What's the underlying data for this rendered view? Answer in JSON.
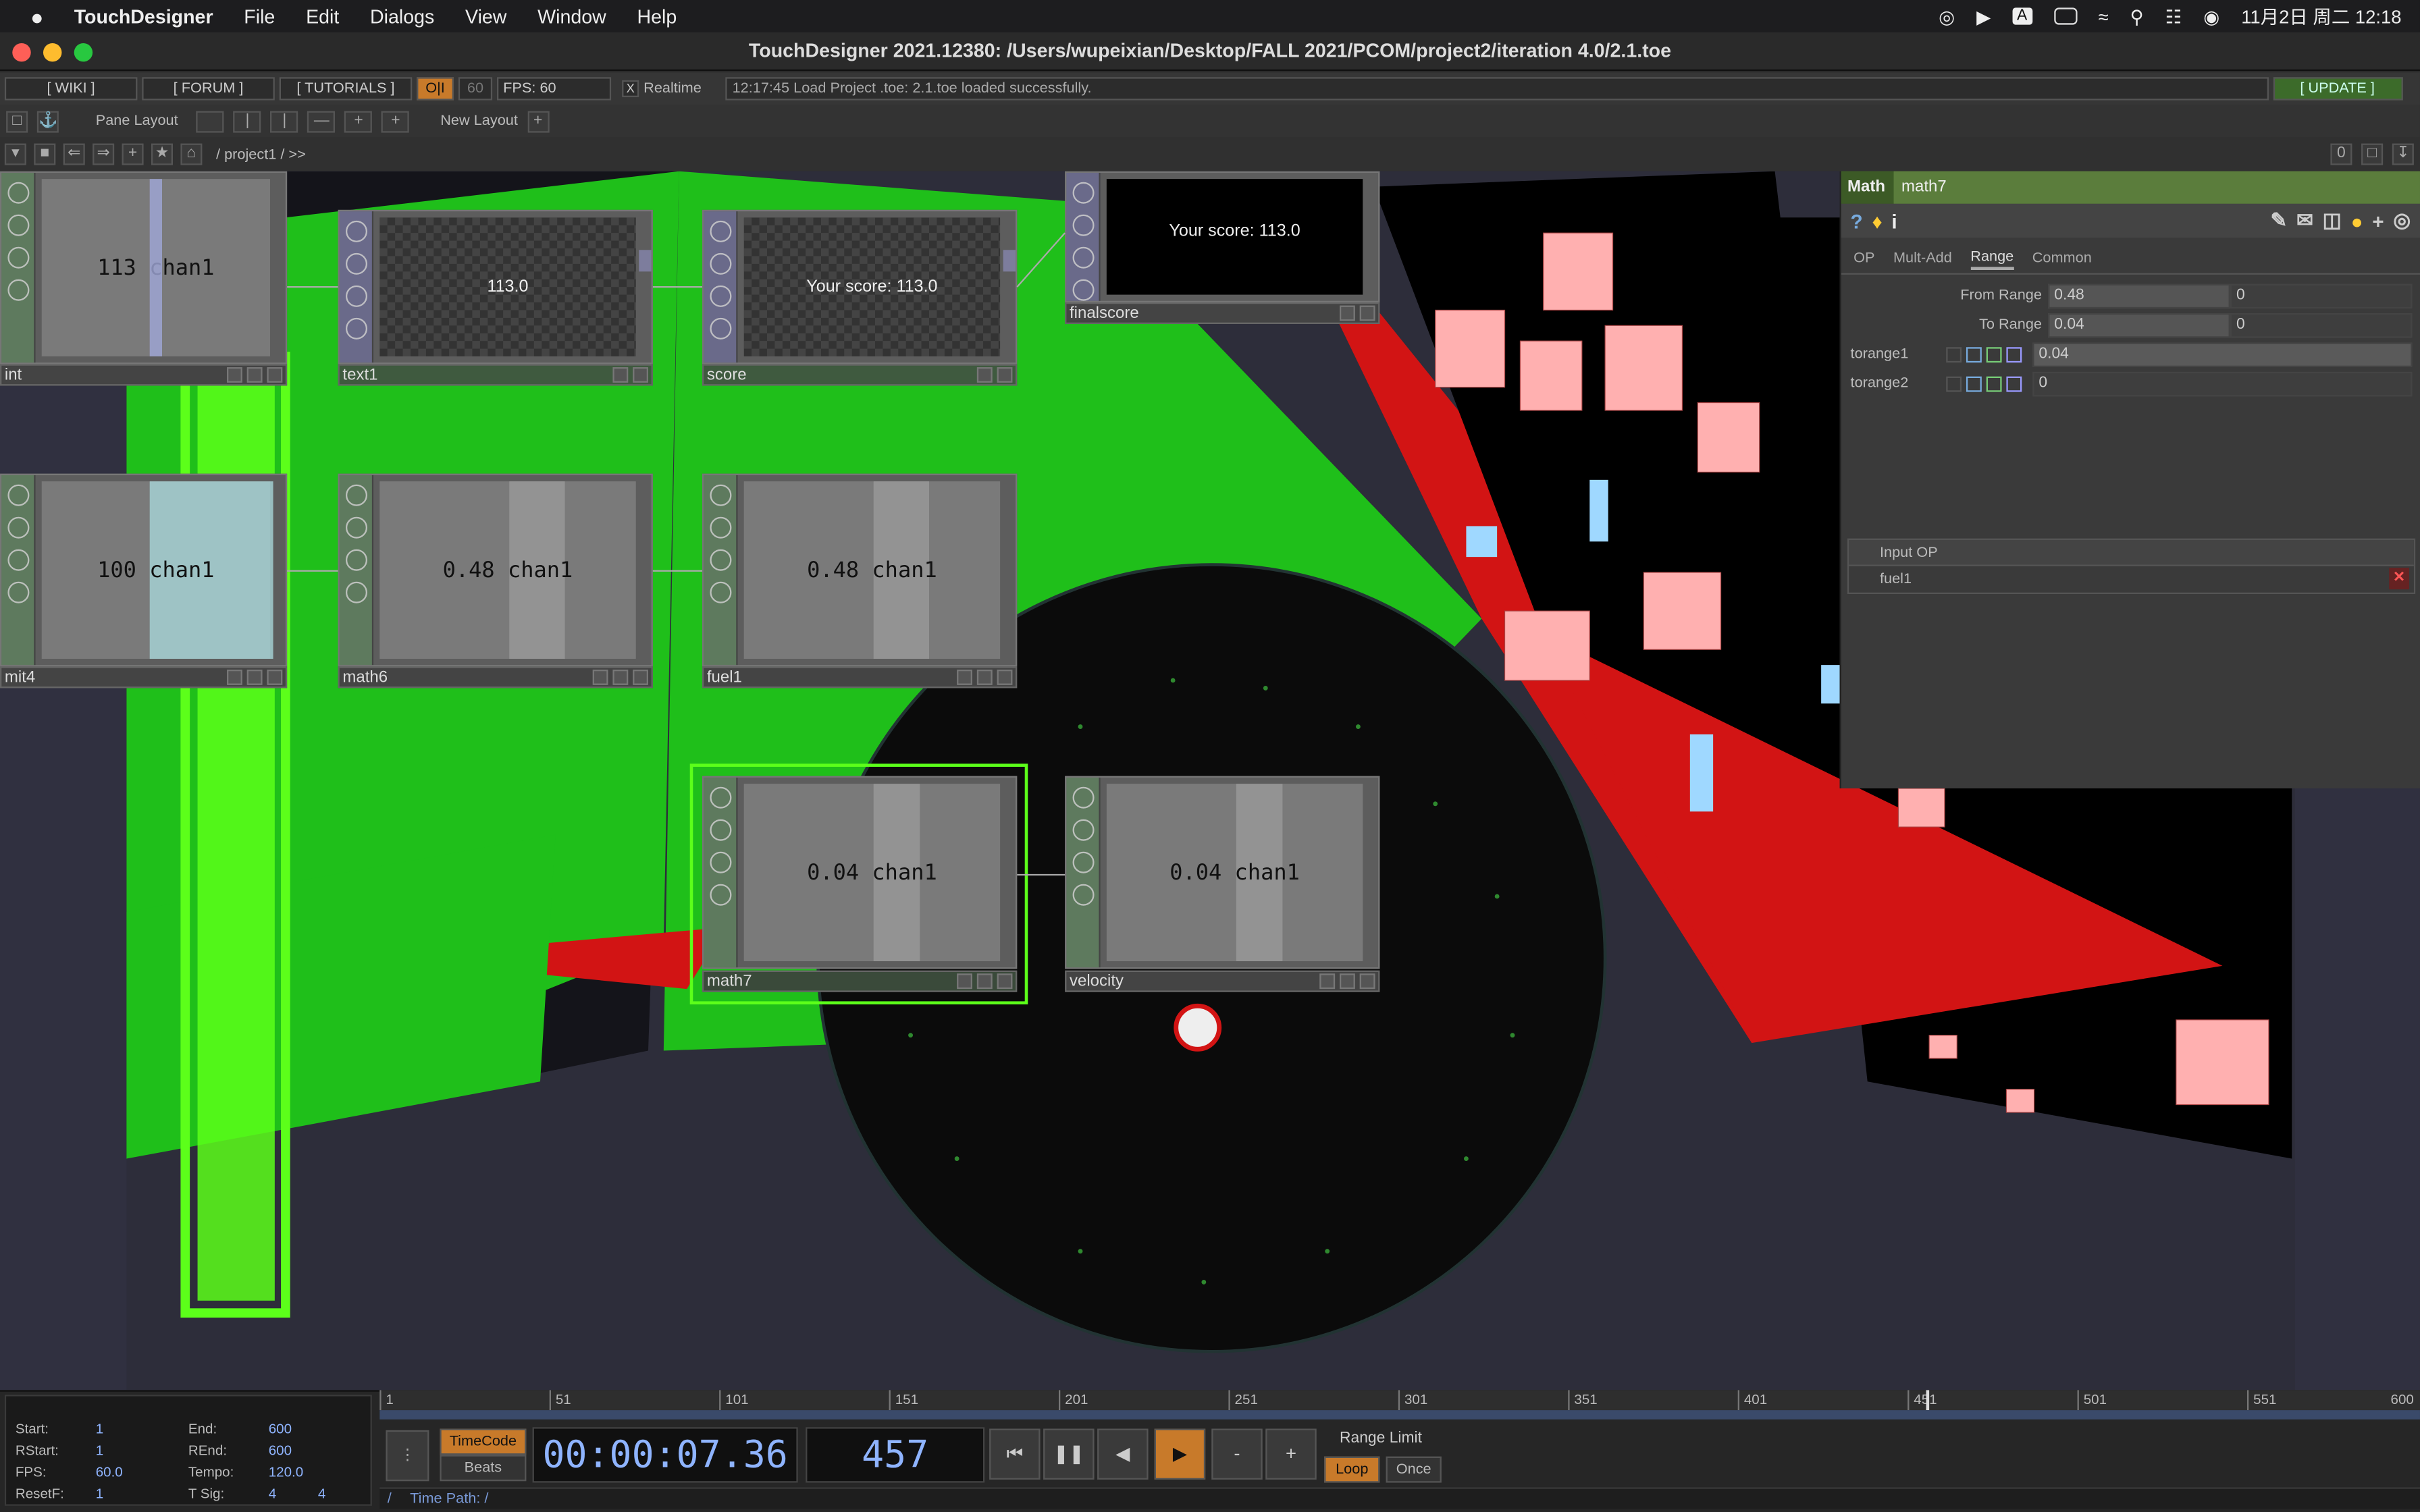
{
  "menubar": {
    "app": "TouchDesigner",
    "items": [
      "File",
      "Edit",
      "Dialogs",
      "View",
      "Window",
      "Help"
    ],
    "datetime": "11月2日 周二  12:18",
    "input_method": "A"
  },
  "window": {
    "title": "TouchDesigner 2021.12380: /Users/wupeixian/Desktop/FALL 2021/PCOM/project2/iteration 4.0/2.1.toe"
  },
  "toolbar": {
    "wiki": "[ WIKI ]",
    "forum": "[ FORUM ]",
    "tutorials": "[ TUTORIALS ]",
    "perf": "O|I",
    "fps_value": "60",
    "fps_label": "FPS:",
    "fps_current": "60",
    "realtime_check": "X",
    "realtime": "Realtime",
    "status": "12:17:45 Load Project .toe: 2.1.toe loaded successfully.",
    "update": "[ UPDATE ]",
    "pane_layout": "Pane Layout",
    "new_layout": "New Layout",
    "plus": "+",
    "path": "/ project1 / >>",
    "pane_index": "0"
  },
  "nodes": [
    {
      "id": "int",
      "label": "int",
      "value": "113",
      "chan": "chan1"
    },
    {
      "id": "text1",
      "label": "text1",
      "value": "113.0"
    },
    {
      "id": "score",
      "label": "score",
      "value": "Your score: 113.0"
    },
    {
      "id": "finalscore",
      "label": "finalscore",
      "value": "Your score: 113.0"
    },
    {
      "id": "mit4",
      "label": "mit4",
      "value": "100",
      "chan": "chan1"
    },
    {
      "id": "math6",
      "label": "math6",
      "value": "0.48",
      "chan": "chan1"
    },
    {
      "id": "fuel1",
      "label": "fuel1",
      "value": "0.48",
      "chan": "chan1"
    },
    {
      "id": "math7",
      "label": "math7",
      "value": "0.04",
      "chan": "chan1"
    },
    {
      "id": "velocity",
      "label": "velocity",
      "value": "0.04",
      "chan": "chan1"
    }
  ],
  "params": {
    "type": "Math",
    "name": "math7",
    "tabs": [
      "OP",
      "Mult-Add",
      "Range",
      "Common"
    ],
    "active_tab": "Range",
    "from_range_label": "From Range",
    "from_range": [
      "0.48",
      "0"
    ],
    "to_range_label": "To Range",
    "to_range": [
      "0.04",
      "0"
    ],
    "torange1_label": "torange1",
    "torange1": "0.04",
    "torange2_label": "torange2",
    "torange2": "0",
    "input_op_label": "Input OP",
    "input_op": "fuel1"
  },
  "timeline": {
    "ticks": [
      "1",
      "51",
      "101",
      "151",
      "201",
      "251",
      "301",
      "351",
      "401",
      "451",
      "501",
      "551",
      "600"
    ],
    "start_label": "Start:",
    "start": "1",
    "end_label": "End:",
    "end": "600",
    "rstart_label": "RStart:",
    "rstart": "1",
    "rend_label": "REnd:",
    "rend": "600",
    "fps_label": "FPS:",
    "fps": "60.0",
    "tempo_label": "Tempo:",
    "tempo": "120.0",
    "resetf_label": "ResetF:",
    "resetf": "1",
    "tsig_label": "T Sig:",
    "tsig": [
      "4",
      "4"
    ],
    "timecode_btn": "TimeCode",
    "beats_btn": "Beats",
    "timecode": "00:00:07.36",
    "frame": "457",
    "minus": "-",
    "plus": "+",
    "range_limit": "Range Limit",
    "loop": "Loop",
    "once": "Once",
    "time_path_prefix": "/",
    "time_path": "Time Path: /"
  },
  "colors": {
    "accent_green": "#4c6b32",
    "orange": "#c87a2a",
    "neon": "#5cff1a"
  }
}
